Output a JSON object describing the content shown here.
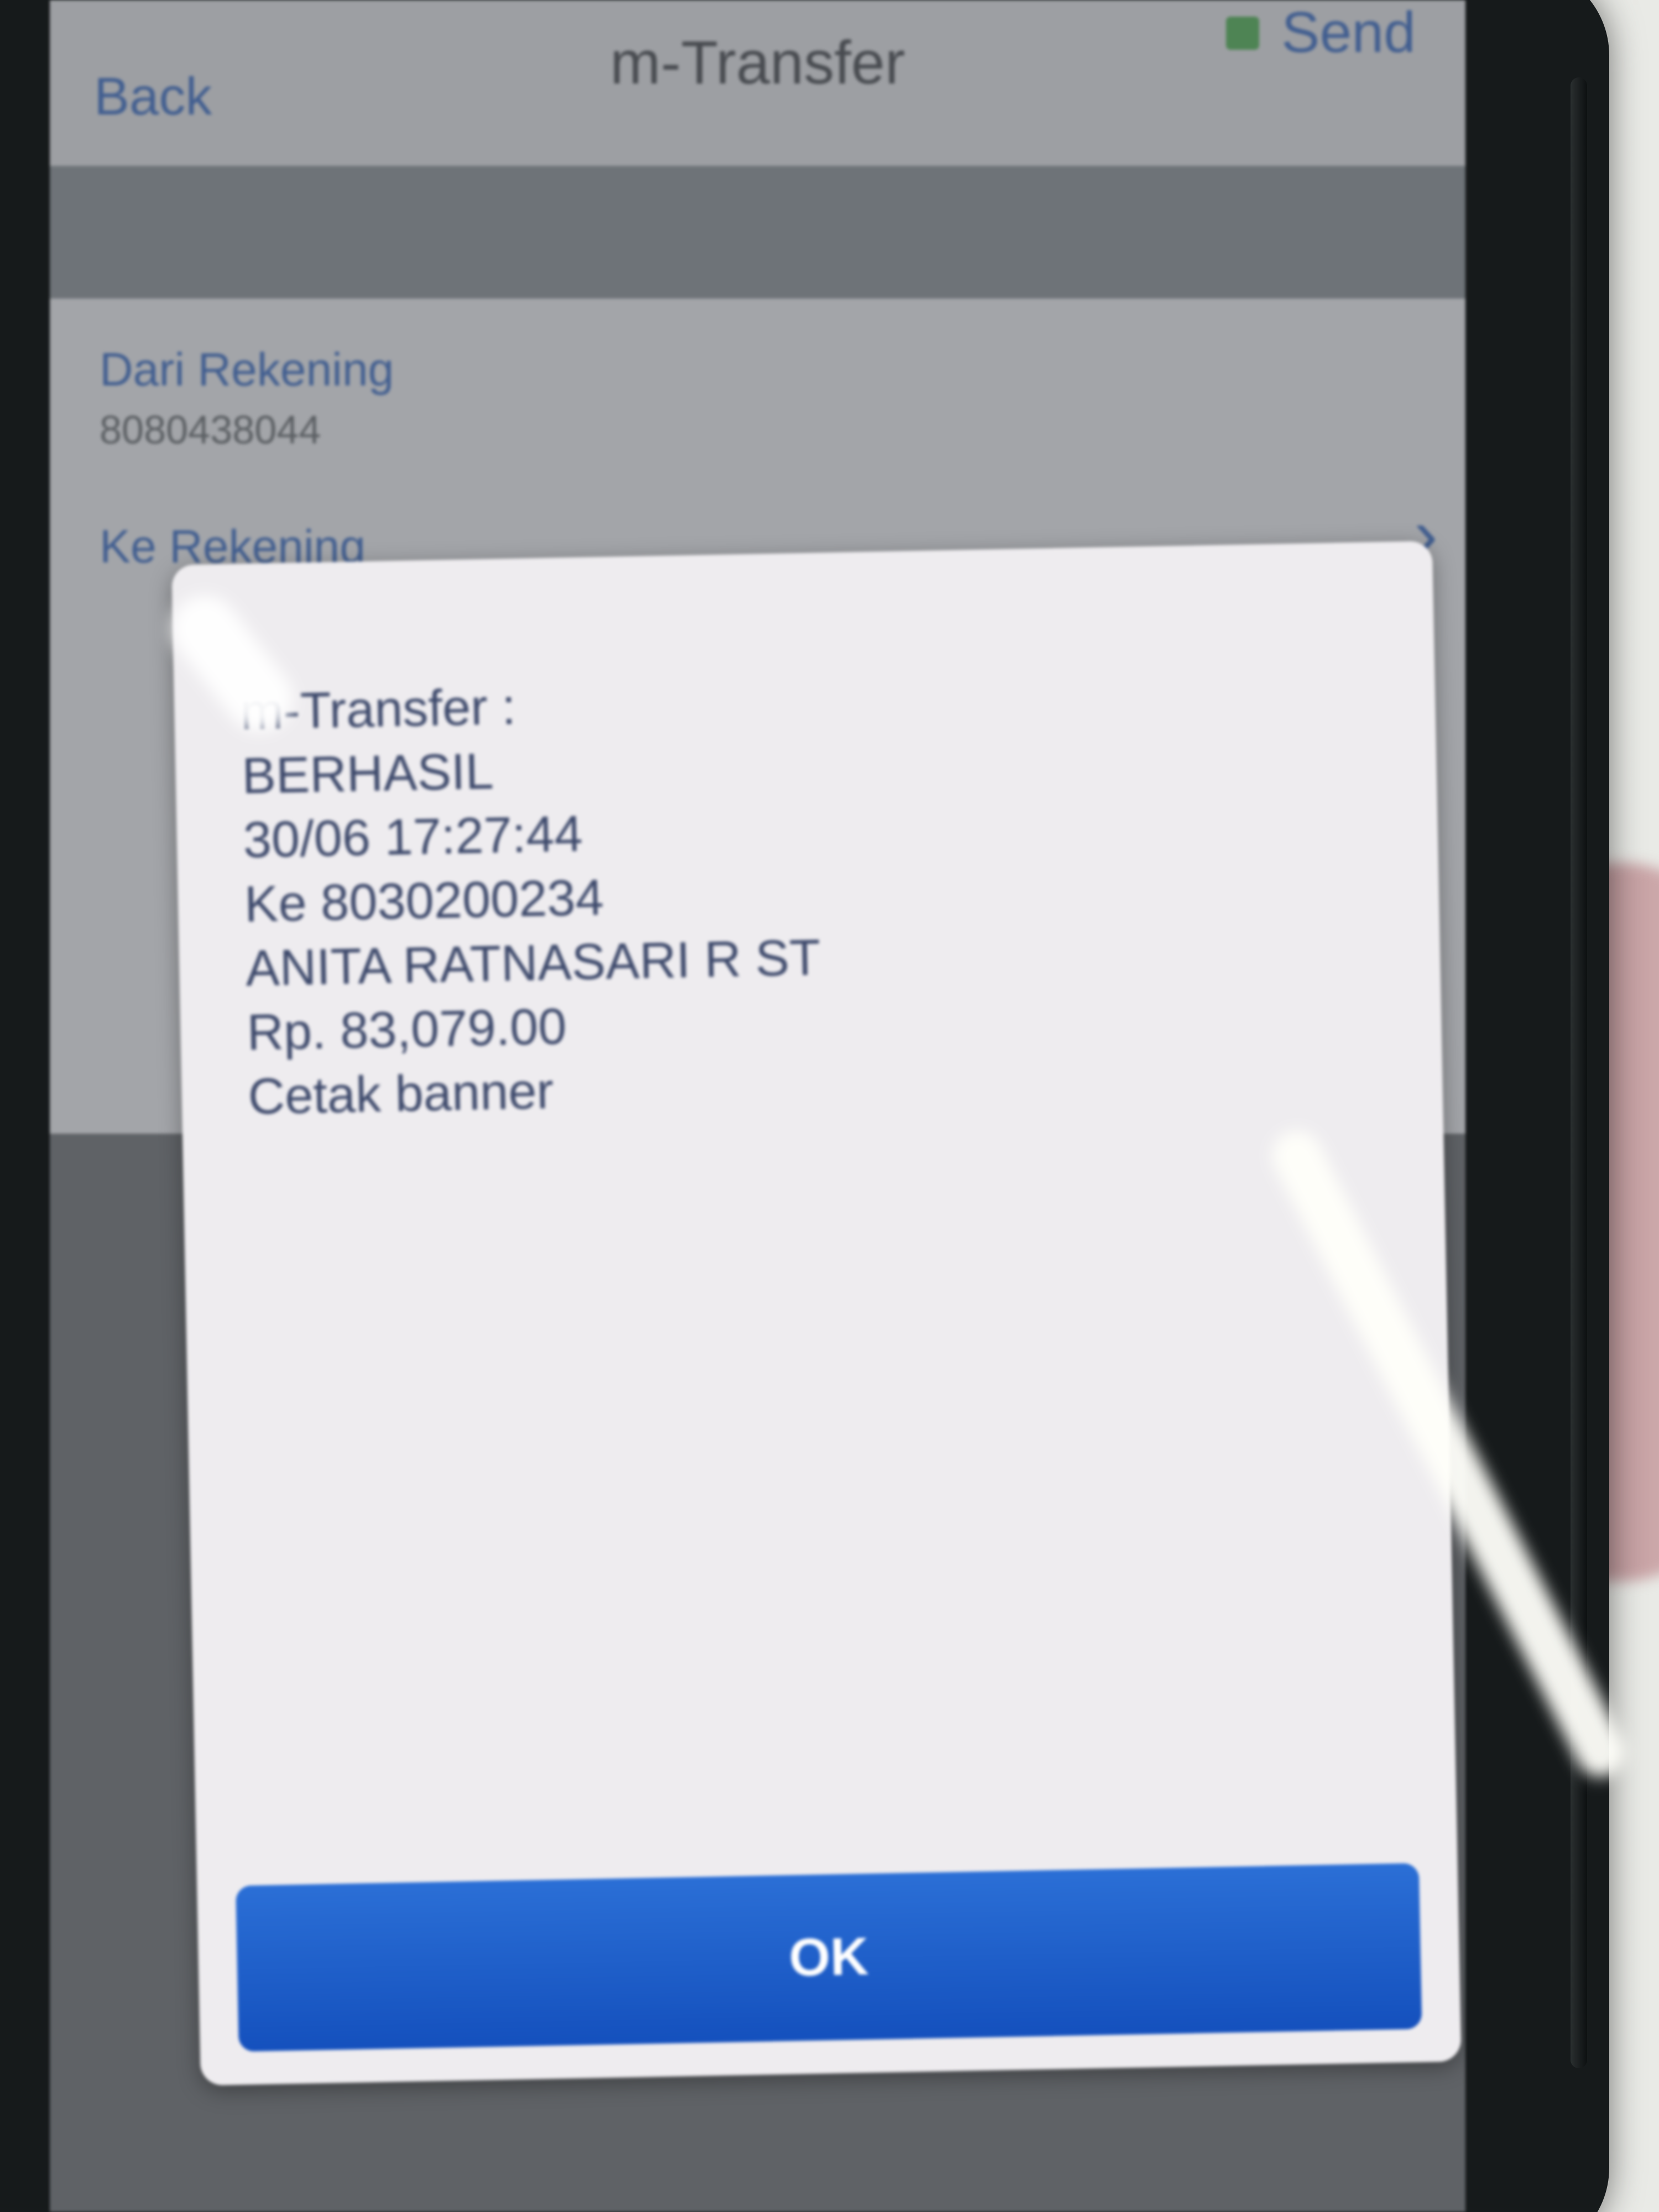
{
  "navbar": {
    "back_label": "Back",
    "title": "m-Transfer",
    "send_label": "Send"
  },
  "form": {
    "from_label": "Dari Rekening",
    "from_value": "8080438044",
    "to_label": "Ke Rekening"
  },
  "dialog": {
    "lines": [
      "m-Transfer :",
      "BERHASIL",
      "30/06 17:27:44",
      "Ke 8030200234",
      "ANITA RATNASARI R ST",
      "Rp. 83,079.00",
      "Cetak banner"
    ],
    "ok_label": "OK"
  },
  "colors": {
    "accent": "#3d6fc6",
    "ok_button": "#1a5cc8",
    "send_indicator": "#55b45a"
  },
  "icons": {
    "chevron": "chevron-right-icon",
    "send_status": "send-status-icon"
  }
}
